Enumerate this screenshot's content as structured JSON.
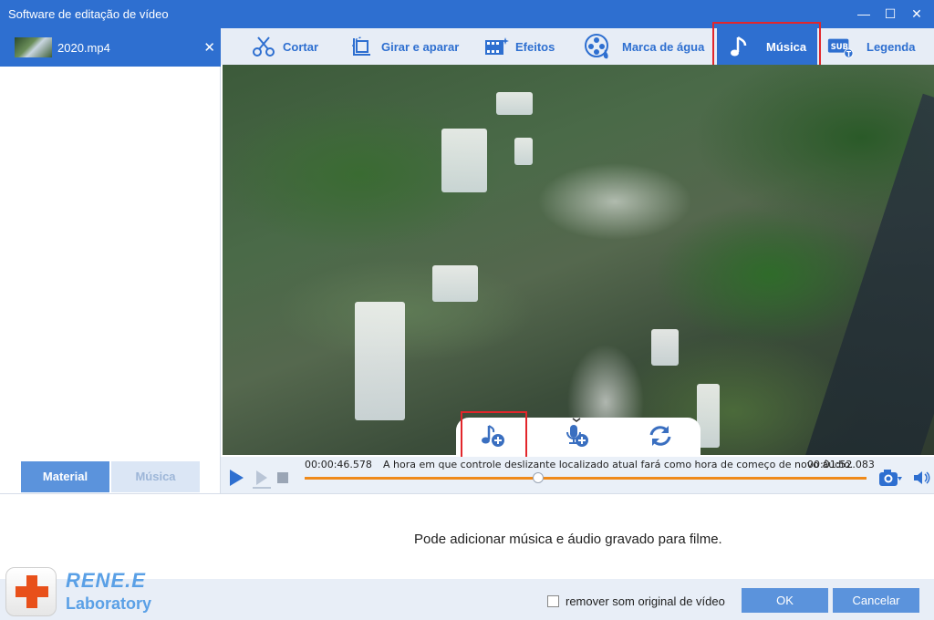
{
  "window": {
    "title": "Software de editação de vídeo"
  },
  "file_list": {
    "items": [
      {
        "name": "2020.mp4"
      }
    ]
  },
  "left_tabs": [
    {
      "label": "Material",
      "active": true
    },
    {
      "label": "Música",
      "active": false
    }
  ],
  "toolbar": {
    "tools": [
      {
        "label": "Cortar",
        "icon": "scissors-icon"
      },
      {
        "label": "Girar e aparar",
        "icon": "crop-rotate-icon"
      },
      {
        "label": "Efeitos",
        "icon": "film-effects-icon"
      },
      {
        "label": "Marca de água",
        "icon": "watermark-reel-icon"
      },
      {
        "label": "Música",
        "icon": "music-note-icon",
        "active": true
      },
      {
        "label": "Legenda",
        "icon": "subtitle-icon"
      }
    ]
  },
  "audio_actions": [
    {
      "icon": "add-music-icon"
    },
    {
      "icon": "record-voice-icon"
    },
    {
      "icon": "refresh-icon"
    }
  ],
  "timeline": {
    "current_time": "00:00:46.578",
    "total_time": "00:01:52.083",
    "hint": "A hora em que controle deslizante localizado atual fará como hora de começo de novo áudio.",
    "progress": 0.416
  },
  "info": {
    "message": "Pode adicionar música e áudio gravado para filme."
  },
  "footer": {
    "logo_line1": "RENE.E",
    "logo_line2": "Laboratory",
    "remove_original_label": "remover som original de vídeo",
    "remove_original_checked": false,
    "ok_label": "OK",
    "cancel_label": "Cancelar"
  },
  "colors": {
    "accent": "#2e6fd0",
    "highlight": "#e2262b",
    "progress": "#ef8a1a"
  }
}
